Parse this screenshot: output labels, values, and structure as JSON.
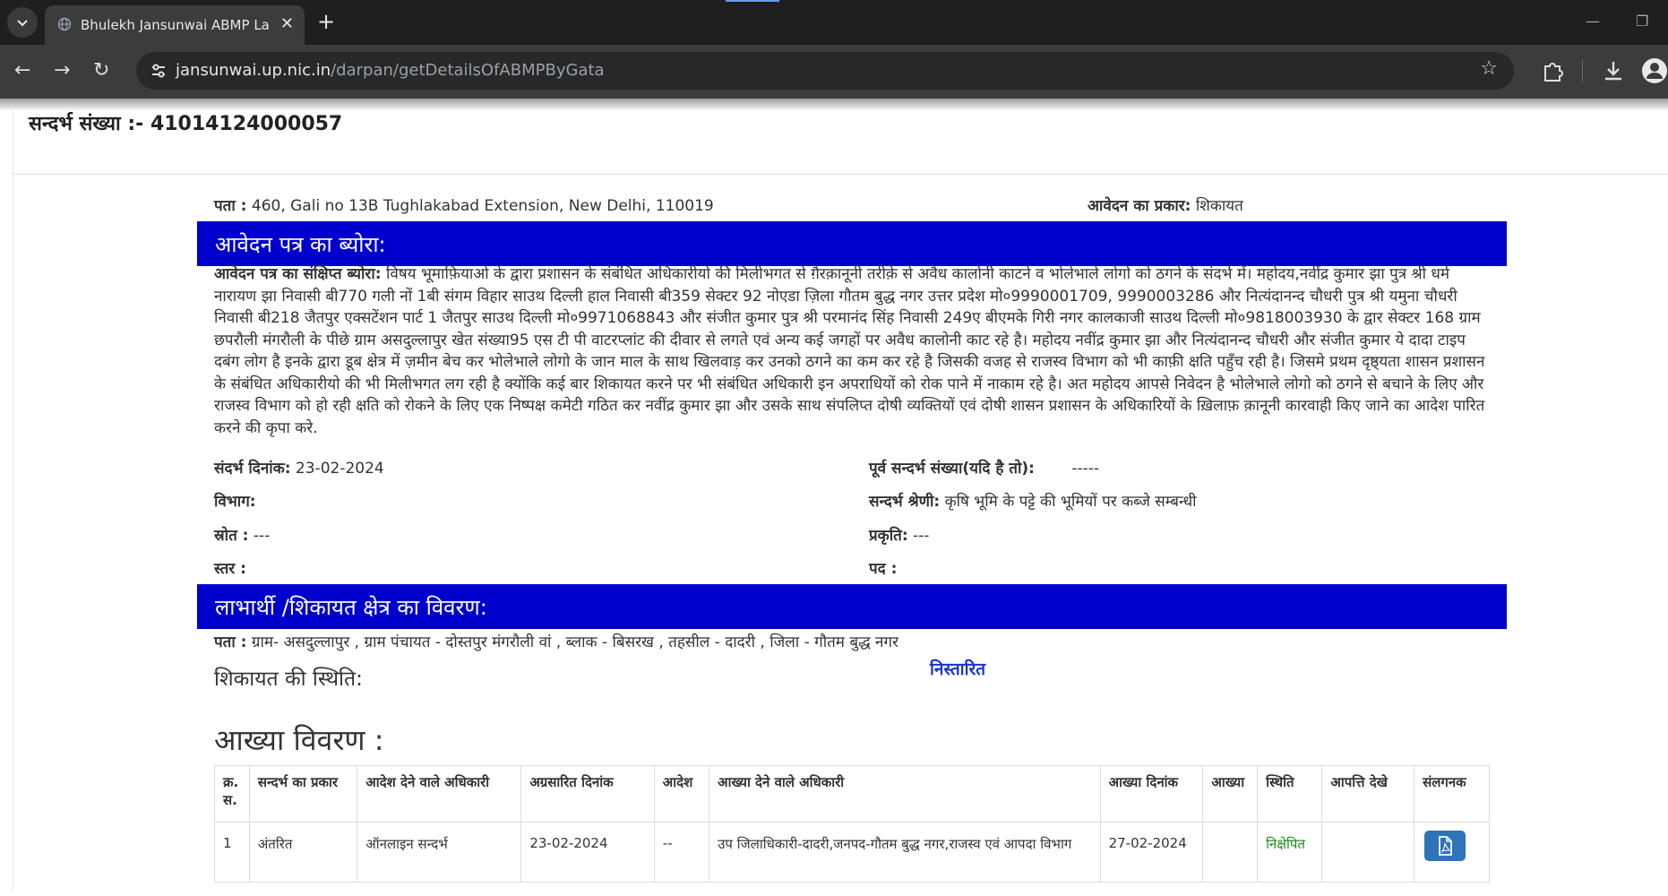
{
  "browser": {
    "tab_title": "Bhulekh Jansunwai ABMP Land",
    "url_host": "jansunwai.up.nic.in",
    "url_path": "/darpan/getDetailsOfABMPByGata"
  },
  "header": {
    "reference_label": "सन्दर्भ संख्या :-",
    "reference_number": "41014124000057"
  },
  "applicant": {
    "address_label": "पता :",
    "address_value": "460, Gali no 13B Tughlakabad Extension, New Delhi, 110019",
    "type_label": "आवेदन का प्रकार:",
    "type_value": "शिकायत"
  },
  "section_application": {
    "title": "आवेदन पत्र का ब्योरा:",
    "summary_label": "आवेदन पत्र का संक्षिप्त ब्योरा:",
    "summary_text": "विषय भूमाफ़ियाओ के द्वारा प्रशासन के संबंधित अधिकारीयो की मिलीभगत से ग़ैरक़ानूनी तरीक़े से अवैध कालोनी काटने व भोलेभाले लोगो को ठगने के संदर्भ में। महोदय,नवींद्र कुमार झा पुत्र श्री धर्म नारायण झा निवासी बी770 गली नों 1बी संगम विहार साउथ दिल्ली हाल निवासी बी359 सेक्टर 92 नोएडा ज़िला गौतम बुद्ध नगर उत्तर प्रदेश मो०9990001709, 9990003286 और नित्यंदानन्द चौधरी पुत्र श्री यमुना चौधरी निवासी बी218 जैतपुर एक्सटेंशन पार्ट 1 जैतपुर साउथ दिल्ली मो०9971068843 और संजीत कुमार पुत्र श्री परमानंद सिंह निवासी 249ए बीएमके गिरी नगर कालकाजी साउथ दिल्ली मो०9818003930 के द्वार सेक्टर 168 ग्राम छपरौली मंगरौली के पीछे ग्राम असदुल्लापुर खेत संख्या95 एस टी पी वाटरप्लांट की दीवार से लगते एवं अन्य कई जगहों पर अवैध कालोनी काट रहे है। महोदय नवींद्र कुमार झा और नित्यंदानन्द चौधरी और संजीत कुमार ये दादा टाइप दबंग लोग है इनके द्वारा डूब क्षेत्र में ज़मीन बेच कर भोलेभाले लोगो के जान माल के साथ खिलवाड़ कर उनको ठगने का कम कर रहे है जिसकी वजह से राजस्व विभाग को भी काफ़ी क्षति पहुँच रही है। जिसमे प्रथम दृष्ठ्यता शासन प्रशासन के संबंधित अधिकारीयो की भी मिलीभगत लग रही है क्योंकि कई बार शिकायत करने पर भी संबंधित अधिकारी इन अपराधियों को रोक पाने में नाकाम रहे है। अत महोदय आपसे निवेदन है भोलेभाले लोगो को ठगने से बचाने के लिए और राजस्व विभाग को हो रही क्षति को रोकने के लिए एक निष्पक्ष कमेटी गठित कर नवींद्र कुमार झा और उसके साथ संपलिप्त दोषी व्यक्तियों एवं दोषी शासन प्रशासन के अधिकारियों के ख़िलाफ़ क़ानूनी कारवाही किए जाने का आदेश पारित करने की कृपा करे.",
    "ref_date_label": "संदर्भ दिनांक:",
    "ref_date_value": "23-02-2024",
    "prev_ref_label": "पूर्व सन्दर्भ संख्या(यदि है तो):",
    "prev_ref_value": "-----",
    "department_label": "विभाग:",
    "category_label": "सन्दर्भ श्रेणी:",
    "category_value": "कृषि भूमि के पट्टे की भूमियों पर कब्जे सम्बन्धी",
    "source_label": "स्रोत :",
    "source_value": "---",
    "nature_label": "प्रकृति:",
    "nature_value": "---",
    "level_label": "स्तर :",
    "post_label": "पद :"
  },
  "section_beneficiary": {
    "title": "लाभार्थी /शिकायत क्षेत्र का विवरण:",
    "address_label": "पता :",
    "address_value": "ग्राम- असदुल्लापुर , ग्राम पंचायत - दोस्तपुर मंगरौली वां , ब्लाक - बिसरख , तहसील - दादरी , जिला - गौतम बुद्ध नगर"
  },
  "complaint_status": {
    "label": "शिकायत की स्थिति:",
    "value": "निस्तारित"
  },
  "akhya": {
    "title": "आख्या विवरण :",
    "columns": [
      "क्र. स.",
      "सन्दर्भ का प्रकार",
      "आदेश देने वाले अधिकारी",
      "अग्रसारित दिनांक",
      "आदेश",
      "आख्या देने वाले अधिकारी",
      "आख्या दिनांक",
      "आख्या",
      "स्थिति",
      "आपत्ति देखे",
      "संलगनक"
    ],
    "rows": [
      {
        "sno": "1",
        "ref_type": "अंतरित",
        "ordering_officer": "ऑनलाइन सन्दर्भ",
        "forward_date": "23-02-2024",
        "order": "--",
        "reporting_officer": "उप जिलाधिकारी-दादरी,जनपद-गौतम बुद्ध नगर,राजस्व एवं आपदा विभाग",
        "report_date": "27-02-2024",
        "report": "",
        "status": "निक्षेपित",
        "objection": "",
        "attachment_icon": "pdf-file-icon"
      }
    ]
  },
  "colors": {
    "section_bar": "#0000cc",
    "status_link": "#1a33cc",
    "status_green": "#188a18",
    "attachment_button": "#2f73b8"
  }
}
